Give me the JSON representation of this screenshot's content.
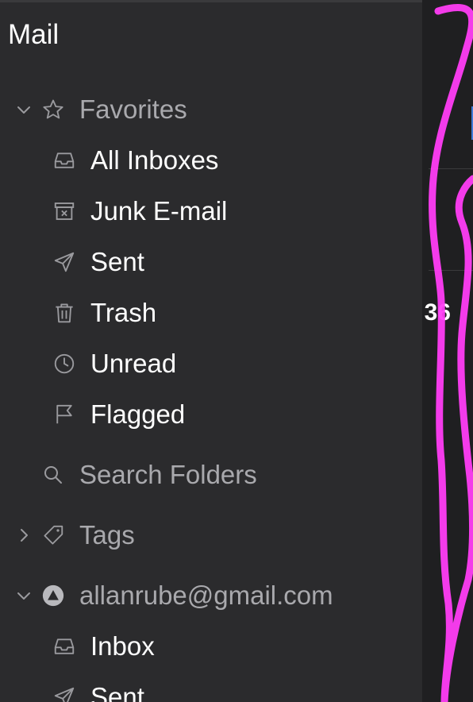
{
  "app": {
    "title": "Mail"
  },
  "favorites": {
    "label": "Favorites",
    "items": [
      {
        "label": "All Inboxes",
        "icon": "tray-icon"
      },
      {
        "label": "Junk E-mail",
        "icon": "junk-icon"
      },
      {
        "label": "Sent",
        "icon": "paper-plane-icon"
      },
      {
        "label": "Trash",
        "icon": "trash-icon",
        "badge": "36"
      },
      {
        "label": "Unread",
        "icon": "clock-icon"
      },
      {
        "label": "Flagged",
        "icon": "flag-icon"
      }
    ]
  },
  "search_folders": {
    "label": "Search Folders",
    "icon": "search-icon"
  },
  "tags": {
    "label": "Tags",
    "icon": "tag-icon"
  },
  "account": {
    "label": "allanrube@gmail.com",
    "icon": "account-icon",
    "items": [
      {
        "label": "Inbox",
        "icon": "tray-icon"
      },
      {
        "label": "Sent",
        "icon": "paper-plane-icon"
      }
    ]
  },
  "colors": {
    "background": "#2b2b2d",
    "section_text": "#a9a9ad",
    "item_text": "#ffffff",
    "icon": "#9a9a9e",
    "annotation": "#ff3df5"
  }
}
